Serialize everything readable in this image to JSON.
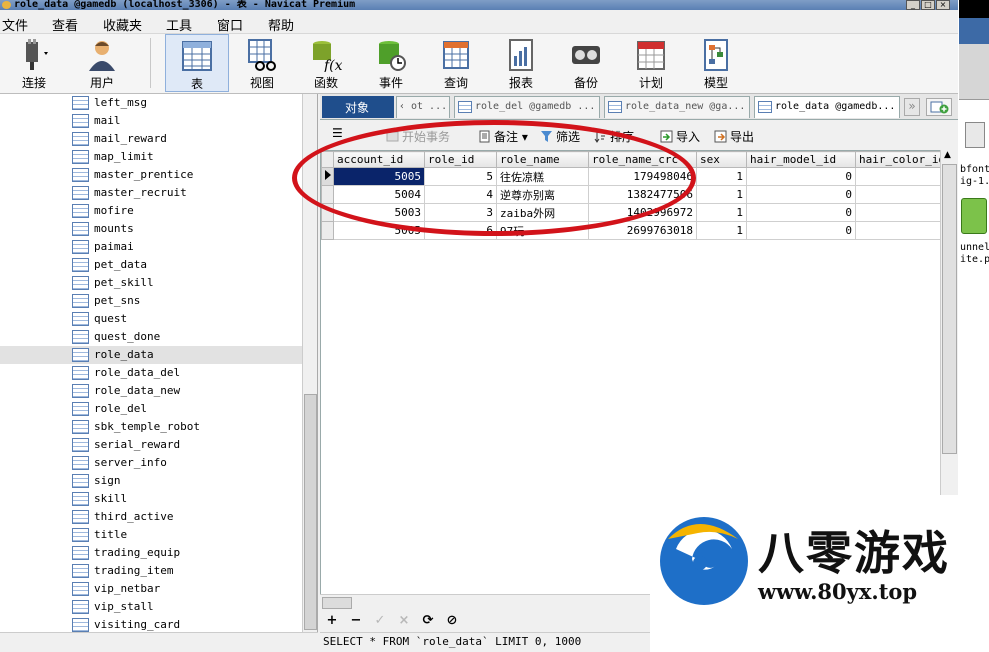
{
  "window": {
    "title": "role_data @gamedb (localhost_3306) - 表 - Navicat Premium",
    "buttons": [
      "_",
      "□",
      "×"
    ]
  },
  "menu": [
    "文件",
    "查看",
    "收藏夹",
    "工具",
    "窗口",
    "帮助"
  ],
  "toolbar": {
    "items": [
      {
        "name": "connect",
        "label": "连接"
      },
      {
        "name": "user",
        "label": "用户"
      },
      {
        "name": "table",
        "label": "表",
        "active": true
      },
      {
        "name": "view",
        "label": "视图"
      },
      {
        "name": "function",
        "label": "函数"
      },
      {
        "name": "event",
        "label": "事件"
      },
      {
        "name": "query",
        "label": "查询"
      },
      {
        "name": "report",
        "label": "报表"
      },
      {
        "name": "backup",
        "label": "备份"
      },
      {
        "name": "schedule",
        "label": "计划"
      },
      {
        "name": "model",
        "label": "模型"
      }
    ]
  },
  "tree": {
    "items": [
      "left_msg",
      "mail",
      "mail_reward",
      "map_limit",
      "master_prentice",
      "master_recruit",
      "mofire",
      "mounts",
      "paimai",
      "pet_data",
      "pet_skill",
      "pet_sns",
      "quest",
      "quest_done",
      "role_data",
      "role_data_del",
      "role_data_new",
      "role_del",
      "sbk_temple_robot",
      "serial_reward",
      "server_info",
      "sign",
      "skill",
      "third_active",
      "title",
      "trading_equip",
      "trading_item",
      "vip_netbar",
      "vip_stall",
      "visiting_card"
    ],
    "selected": "role_data"
  },
  "tabs": {
    "objects": "对象",
    "items": [
      "ot ...",
      "role_del @gamedb ...",
      "role_data_new @ga...",
      "role_data @gamedb..."
    ],
    "current_index": 3
  },
  "subtoolbar": {
    "begin_transaction": "开始事务",
    "memo": "备注",
    "filter": "筛选",
    "sort": "排序",
    "import": "导入",
    "export": "导出"
  },
  "grid": {
    "columns": [
      "account_id",
      "role_id",
      "role_name",
      "role_name_crc",
      "sex",
      "hair_model_id",
      "hair_color_id"
    ],
    "rows": [
      {
        "account_id": "5005",
        "role_id": "5",
        "role_name": "往佐凉糕",
        "role_name_crc": "179498046",
        "sex": "1",
        "hair_model_id": "0",
        "hair_color_id": ""
      },
      {
        "account_id": "5004",
        "role_id": "4",
        "role_name": "逆尊亦别离",
        "role_name_crc": "1382477506",
        "sex": "1",
        "hair_model_id": "0",
        "hair_color_id": ""
      },
      {
        "account_id": "5003",
        "role_id": "3",
        "role_name": "zaiba外网",
        "role_name_crc": "1402996972",
        "sex": "1",
        "hair_model_id": "0",
        "hair_color_id": ""
      },
      {
        "account_id": "5005",
        "role_id": "6",
        "role_name": "97玩",
        "role_name_crc": "2699763018",
        "sex": "1",
        "hair_model_id": "0",
        "hair_color_id": ""
      }
    ],
    "selected_row": 0
  },
  "navbar": [
    "+",
    "−",
    "✓",
    "×",
    "⟳",
    "⊘"
  ],
  "sql": "SELECT * FROM `role_data` LIMIT 0, 1000",
  "side_window": {
    "lines": [
      "bfont",
      "ig-1.",
      "unnel",
      "ite.p"
    ]
  },
  "watermark": {
    "title": "八零游戏",
    "url": "www.80yx.top"
  },
  "colors": {
    "accent": "#1f4e8c",
    "selection": "#0a246a",
    "highlight": "#d2131a"
  }
}
